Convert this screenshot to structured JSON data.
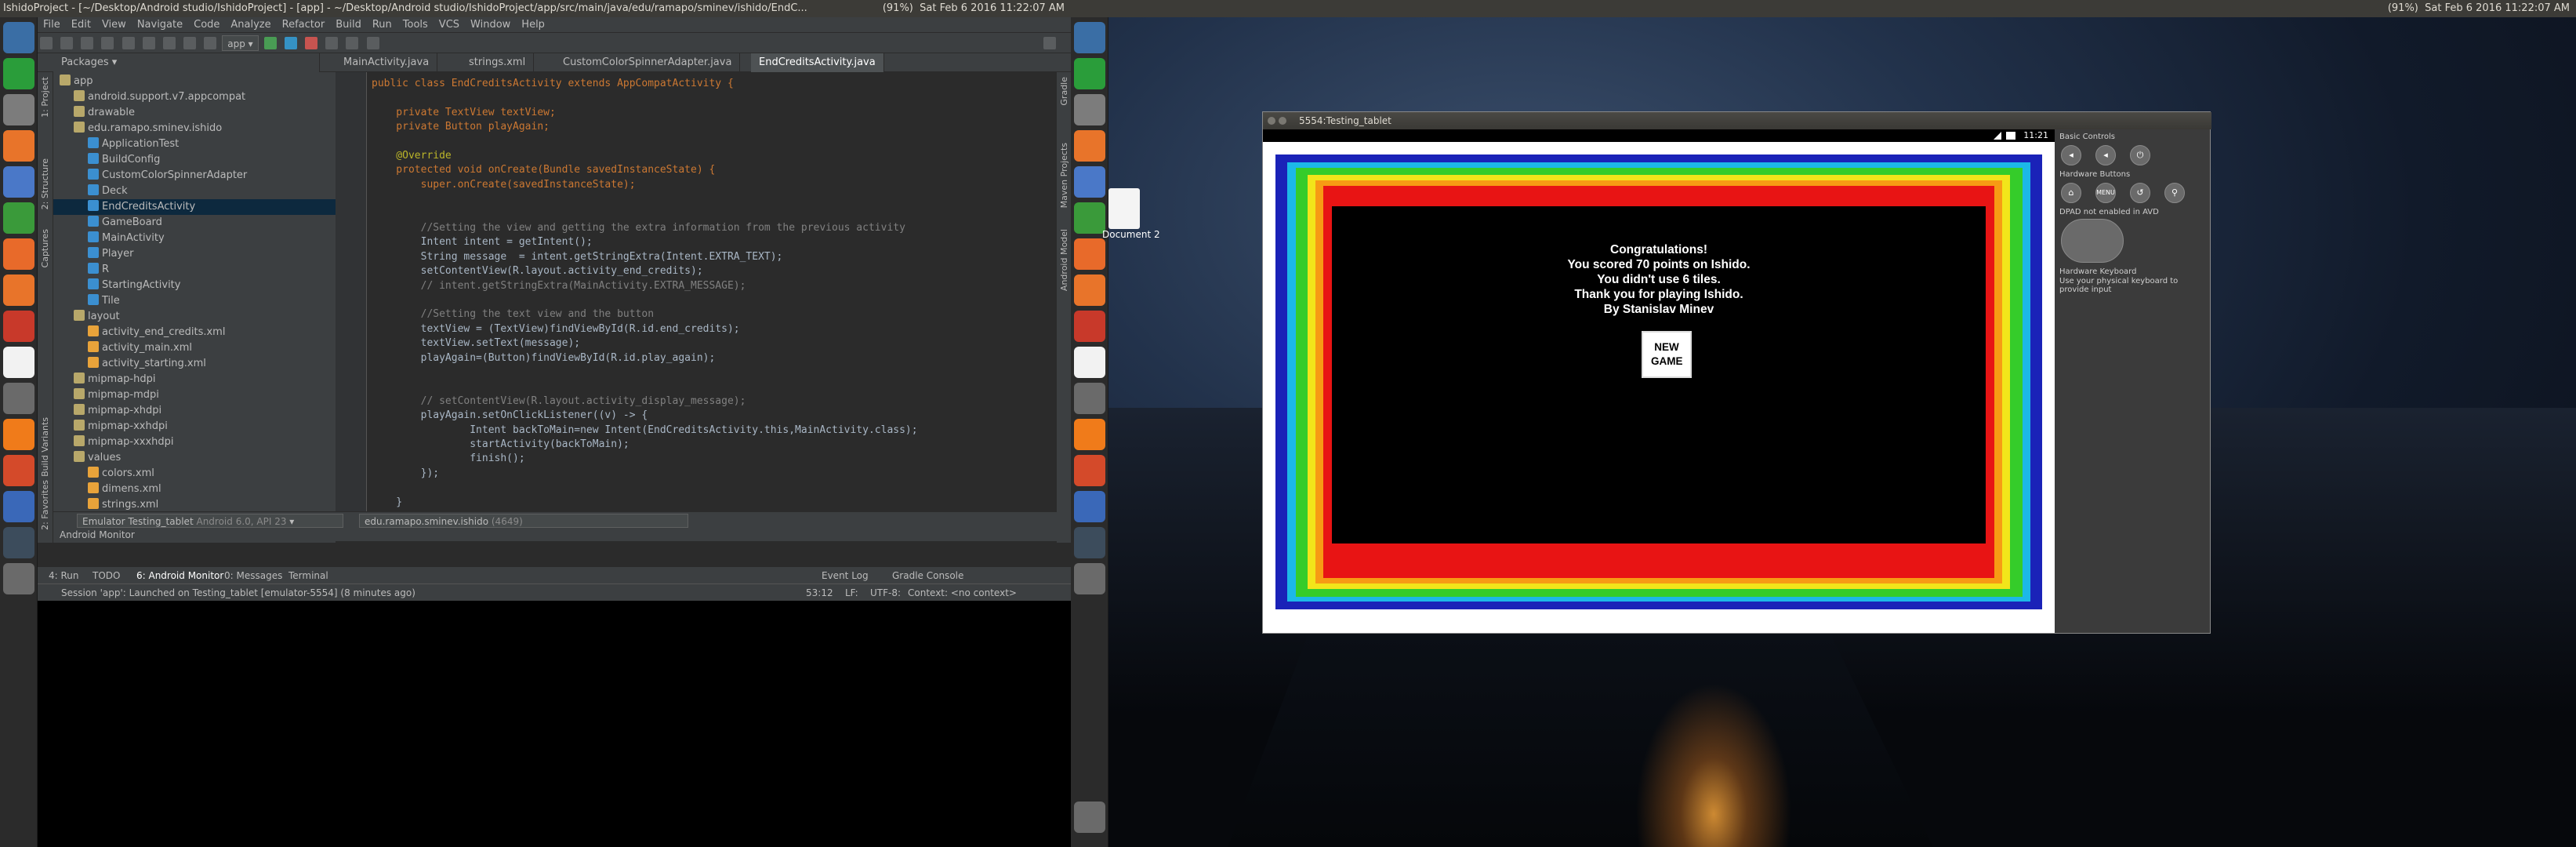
{
  "left_top_bar": {
    "title": "IshidoProject - [~/Desktop/Android studio/IshidoProject] - [app] - ~/Desktop/Android studio/IshidoProject/app/src/main/java/edu/ramapo/sminev/ishido/EndC...",
    "battery": "(91%)",
    "datetime": "Sat Feb 6 2016 11:22:07 AM"
  },
  "right_top_bar": {
    "battery": "(91%)",
    "datetime": "Sat Feb 6 2016 11:22:07 AM"
  },
  "menu": [
    "File",
    "Edit",
    "View",
    "Navigate",
    "Code",
    "Analyze",
    "Refactor",
    "Build",
    "Run",
    "Tools",
    "VCS",
    "Window",
    "Help"
  ],
  "toolbar": {
    "run_config": "app"
  },
  "project_panel": {
    "view_mode": "Packages",
    "side_tabs": [
      "1: Project",
      "2: Structure",
      "Captures",
      "Build Variants",
      "2: Favorites"
    ],
    "tree": [
      {
        "label": "app",
        "indent": 0
      },
      {
        "label": "android.support.v7.appcompat",
        "indent": 1
      },
      {
        "label": "drawable",
        "indent": 1
      },
      {
        "label": "edu.ramapo.sminev.ishido",
        "indent": 1
      },
      {
        "label": "ApplicationTest",
        "indent": 2
      },
      {
        "label": "BuildConfig",
        "indent": 2
      },
      {
        "label": "CustomColorSpinnerAdapter",
        "indent": 2
      },
      {
        "label": "Deck",
        "indent": 2
      },
      {
        "label": "EndCreditsActivity",
        "indent": 2,
        "selected": true
      },
      {
        "label": "GameBoard",
        "indent": 2
      },
      {
        "label": "MainActivity",
        "indent": 2
      },
      {
        "label": "Player",
        "indent": 2
      },
      {
        "label": "R",
        "indent": 2
      },
      {
        "label": "StartingActivity",
        "indent": 2
      },
      {
        "label": "Tile",
        "indent": 2
      },
      {
        "label": "layout",
        "indent": 1
      },
      {
        "label": "activity_end_credits.xml",
        "indent": 2
      },
      {
        "label": "activity_main.xml",
        "indent": 2
      },
      {
        "label": "activity_starting.xml",
        "indent": 2
      },
      {
        "label": "mipmap-hdpi",
        "indent": 1
      },
      {
        "label": "mipmap-mdpi",
        "indent": 1
      },
      {
        "label": "mipmap-xhdpi",
        "indent": 1
      },
      {
        "label": "mipmap-xxhdpi",
        "indent": 1
      },
      {
        "label": "mipmap-xxxhdpi",
        "indent": 1
      },
      {
        "label": "values",
        "indent": 1
      },
      {
        "label": "colors.xml",
        "indent": 2
      },
      {
        "label": "dimens.xml",
        "indent": 2
      },
      {
        "label": "strings.xml",
        "indent": 2
      }
    ]
  },
  "editor_tabs": [
    "MainActivity.java",
    "strings.xml",
    "CustomColorSpinnerAdapter.java",
    "EndCreditsActivity.java"
  ],
  "active_tab_index": 3,
  "right_side_tabs": [
    "Gradle",
    "Maven Projects",
    "Android Model"
  ],
  "code_lines": [
    "public class EndCreditsActivity extends AppCompatActivity {",
    "",
    "    private TextView textView;",
    "    private Button playAgain;",
    "",
    "    @Override",
    "    protected void onCreate(Bundle savedInstanceState) {",
    "        super.onCreate(savedInstanceState);",
    "",
    "",
    "        //Setting the view and getting the extra information from the previous activity",
    "        Intent intent = getIntent();",
    "        String message  = intent.getStringExtra(Intent.EXTRA_TEXT);",
    "        setContentView(R.layout.activity_end_credits);",
    "        // intent.getStringExtra(MainActivity.EXTRA_MESSAGE);",
    "",
    "        //Setting the text view and the button",
    "        textView = (TextView)findViewById(R.id.end_credits);",
    "        textView.setText(message);",
    "        playAgain=(Button)findViewById(R.id.play_again);",
    "",
    "",
    "        // setContentView(R.layout.activity_display_message);",
    "        playAgain.setOnClickListener((v) -> {",
    "                Intent backToMain=new Intent(EndCreditsActivity.this,MainActivity.class);",
    "                startActivity(backToMain);",
    "                finish();",
    "        });",
    "",
    "    }",
    "}"
  ],
  "android_monitor": {
    "title": "Android Monitor",
    "device": "Emulator Testing_tablet",
    "device_api": "Android 6.0, API 23",
    "process": "edu.ramapo.sminev.ishido",
    "pid": "(4649)"
  },
  "bottom_tabs": [
    "4: Run",
    "TODO",
    "6: Android Monitor",
    "0: Messages",
    "Terminal",
    "Event Log",
    "Gradle Console"
  ],
  "status": {
    "message": "Session 'app': Launched on Testing_tablet [emulator-5554] (8 minutes ago)",
    "position": "53:12",
    "line_sep": "LF:",
    "encoding": "UTF-8:",
    "context": "Context: <no context>"
  },
  "desktop": {
    "icon_label": "Document 2"
  },
  "emulator": {
    "window_title": "5554:Testing_tablet",
    "clock": "11:21",
    "panel_basic": "Basic Controls",
    "panel_hw": "Hardware Buttons",
    "panel_dpad": "DPAD not enabled in AVD",
    "panel_kb": "Hardware Keyboard",
    "panel_kb_note": "Use your physical keyboard to provide input",
    "menu_btn": "MENU",
    "border_colors": [
      "#1a22b8",
      "#1cb8e8",
      "#35cc2a",
      "#f2e51a",
      "#f79b14",
      "#e81414"
    ]
  },
  "app_screen": {
    "lines": [
      "Congratulations!",
      "You scored 70 points on Ishido.",
      "You didn't use 6 tiles.",
      "Thank you for playing Ishido.",
      "By Stanislav Minev"
    ],
    "button": "NEW GAME"
  }
}
